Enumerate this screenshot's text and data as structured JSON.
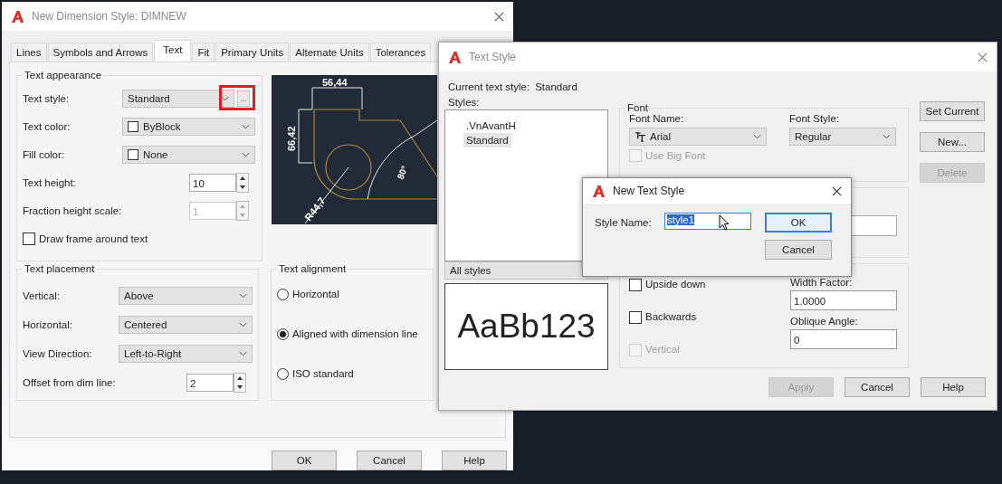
{
  "dim_dialog": {
    "title": "New Dimension Style: DIMNEW",
    "tabs": [
      {
        "label": "Lines",
        "selected": false
      },
      {
        "label": "Symbols and Arrows",
        "selected": false
      },
      {
        "label": "Text",
        "selected": true
      },
      {
        "label": "Fit",
        "selected": false
      },
      {
        "label": "Primary Units",
        "selected": false
      },
      {
        "label": "Alternate Units",
        "selected": false
      },
      {
        "label": "Tolerances",
        "selected": false
      }
    ],
    "appearance": {
      "title": "Text appearance",
      "rows": [
        {
          "kind": "select",
          "label": "Text style:",
          "value": "Standard",
          "browse": "...",
          "highlighted": true
        },
        {
          "kind": "select",
          "label": "Text color:",
          "value": "ByBlock",
          "swatch": true
        },
        {
          "kind": "select",
          "label": "Fill color:",
          "value": "None",
          "swatch": true
        },
        {
          "kind": "spinner",
          "label": "Text height:",
          "value": "10",
          "disabled": false
        },
        {
          "kind": "spinner",
          "label": "Fraction height scale:",
          "value": "1",
          "disabled": true
        },
        {
          "kind": "check",
          "label": "Draw frame around text",
          "checked": false
        }
      ]
    },
    "preview": {
      "top_dim": "56,44",
      "left_dim": "66,42",
      "angle_dim": "80°",
      "radius_dim": "R44,7"
    },
    "placement": {
      "title": "Text placement",
      "rows": [
        {
          "kind": "select",
          "label": "Vertical:",
          "value": "Above"
        },
        {
          "kind": "select",
          "label": "Horizontal:",
          "value": "Centered"
        },
        {
          "kind": "select",
          "label": "View Direction:",
          "value": "Left-to-Right"
        },
        {
          "kind": "spinner",
          "label": "Offset from dim line:",
          "value": "2",
          "disabled": false
        }
      ]
    },
    "alignment": {
      "title": "Text alignment",
      "options": [
        {
          "label": "Horizontal",
          "selected": false
        },
        {
          "label": "Aligned with dimension line",
          "selected": true
        },
        {
          "label": "ISO standard",
          "selected": false
        }
      ]
    },
    "buttons": [
      "OK",
      "Cancel",
      "Help"
    ]
  },
  "text_style": {
    "title": "Text Style",
    "current_label": "Current text style:",
    "current_value": "Standard",
    "styles_label": "Styles:",
    "styles": [
      {
        "name": ".VnAvantH",
        "selected": false
      },
      {
        "name": "Standard",
        "selected": true
      }
    ],
    "filter": "All styles",
    "preview_text": "AaBb123",
    "font": {
      "title": "Font",
      "name_label": "Font Name:",
      "name_value": "Arial",
      "style_label": "Font Style:",
      "style_value": "Regular",
      "big_font": {
        "label": "Use Big Font",
        "checked": false,
        "disabled": true
      }
    },
    "effects": [
      {
        "label": "Upside down",
        "checked": false,
        "disabled": false
      },
      {
        "label": "Backwards",
        "checked": false,
        "disabled": false
      },
      {
        "label": "Vertical",
        "checked": false,
        "disabled": true
      }
    ],
    "width_label": "Width Factor:",
    "width_value": "1.0000",
    "oblique_label": "Oblique Angle:",
    "oblique_value": "0",
    "side_buttons": [
      {
        "label": "Set Current",
        "disabled": false
      },
      {
        "label": "New...",
        "disabled": false
      },
      {
        "label": "Delete",
        "disabled": true
      }
    ],
    "bottom_buttons": [
      {
        "label": "Apply",
        "disabled": true
      },
      {
        "label": "Cancel",
        "disabled": false
      },
      {
        "label": "Help",
        "disabled": false
      }
    ]
  },
  "new_style": {
    "title": "New Text Style",
    "field_label": "Style Name:",
    "value": "style1",
    "value_selected": true,
    "buttons": [
      {
        "label": "OK",
        "default": true
      },
      {
        "label": "Cancel",
        "default": false
      }
    ]
  }
}
